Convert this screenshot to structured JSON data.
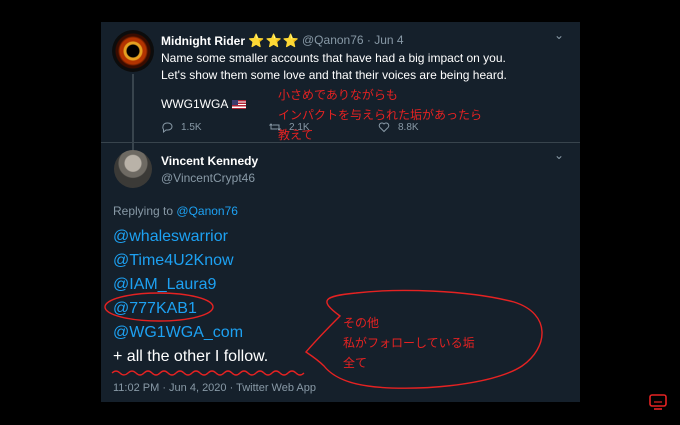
{
  "tweet1": {
    "name": "Midnight Rider",
    "stars": "⭐⭐⭐",
    "handle": "@Qanon76",
    "date": "· Jun 4",
    "line1": "Name some smaller accounts that have had a big impact on you.",
    "line2": "Let's show them some love and that their voices are being heard.",
    "tag": "WWG1WGA",
    "replies": "1.5K",
    "retweets": "2.1K",
    "likes": "8.8K"
  },
  "tweet2": {
    "name": "Vincent Kennedy",
    "handle": "@VincentCrypt46",
    "replying_prefix": "Replying to",
    "replying_to": "@Qanon76",
    "mentions": [
      "@whaleswarrior",
      "@Time4U2Know",
      "@IAM_Laura9",
      "@777KAB1",
      "@WG1WGA_com"
    ],
    "last_line": "+ all the other I follow.",
    "meta": "11:02 PM · Jun 4, 2020 · Twitter Web App"
  },
  "annotations": {
    "note1": [
      "小さめでありながらも",
      "インパクトを与えられた垢があったら",
      "教えて"
    ],
    "note2": [
      "その他",
      "私がフォローしている垢",
      "全て"
    ]
  },
  "colors": {
    "card_bg": "#15202b",
    "link": "#1da1f2",
    "muted": "#8899a6",
    "annotation": "#e52222"
  }
}
